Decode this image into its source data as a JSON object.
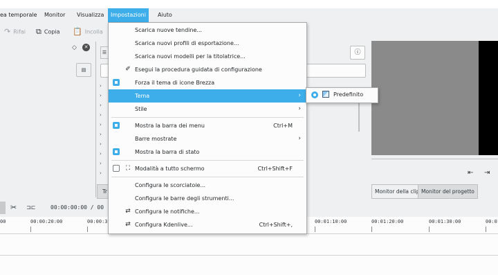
{
  "menubar": {
    "items": [
      "ea temporale",
      "Monitor",
      "Visualizza",
      "Impostazioni",
      "Aiuto"
    ],
    "active": "Impostazioni"
  },
  "toolbar": {
    "redo_label": "Rifai",
    "copy_label": "Copia",
    "paste_label": "Incolla"
  },
  "bin": {
    "tab_label": "Tr"
  },
  "monitor": {
    "clip_tab": "Monitor della clip",
    "project_tab": "Monitor del progetto"
  },
  "timeline": {
    "timecode": "00:00:00:00 / 00",
    "ruler": [
      "00",
      "00:00:20:00",
      "00:00:3",
      "00:01:10:00",
      "00:01:20:00",
      "00:01:30:00",
      "00:01"
    ]
  },
  "menu": {
    "items": [
      {
        "label": "Scarica nuove tendine..."
      },
      {
        "label": "Scarica nuovi profili di esportazione..."
      },
      {
        "label": "Scarica nuovi modelli per la titolatrice..."
      },
      {
        "label": "Esegui la procedura guidata di configurazione",
        "icon": "wand-icon"
      },
      {
        "label": "Forza il tema di icone Brezza",
        "checked": true
      },
      {
        "label": "Tema",
        "submenu": true,
        "highlighted": true
      },
      {
        "label": "Stile",
        "submenu": true
      },
      {
        "label": "Mostra la barra dei menu",
        "checked": true,
        "shortcut": "Ctrl+M"
      },
      {
        "label": "Barre mostrate",
        "submenu": true
      },
      {
        "label": "Mostra la barra di stato",
        "checked": true
      },
      {
        "label": "Modalità a tutto schermo",
        "checked": false,
        "shortcut": "Ctrl+Shift+F",
        "icon": "fullscreen-icon"
      },
      {
        "label": "Configura le scorciatoie..."
      },
      {
        "label": "Configura le barre degli strumenti..."
      },
      {
        "label": "Configura le notifiche...",
        "icon": "sliders-icon"
      },
      {
        "label": "Configura Kdenlive...",
        "shortcut": "Ctrl+Shift+,",
        "icon": "sliders-icon"
      }
    ]
  },
  "submenu": {
    "label": "Predefinito"
  },
  "colors": {
    "accent": "#3daee9",
    "background": "#eff0f1",
    "menu_bg": "#fcfcfc"
  }
}
